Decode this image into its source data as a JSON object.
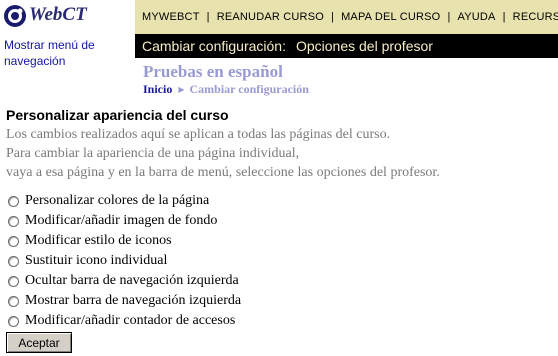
{
  "logo": {
    "text": "WebCT",
    "mark_icon": "webct-logo-icon"
  },
  "topnav": {
    "items": [
      "MYWEBCT",
      "REANUDAR CURSO",
      "MAPA DEL CURSO",
      "AYUDA",
      "RECURSOS"
    ],
    "separator": "|"
  },
  "sidebar": {
    "nav_link": "Mostrar menú de navegación"
  },
  "titlebar": {
    "label": "Cambiar configuración:",
    "value": "Opciones del profesor"
  },
  "course": {
    "title": "Pruebas en español"
  },
  "breadcrumb": {
    "home": "Inicio",
    "current": "Cambiar configuración"
  },
  "section": {
    "heading": "Personalizar apariencia del curso",
    "description": [
      "Los cambios realizados aquí se aplican a todas las páginas del curso.",
      "Para cambiar la apariencia de una página individual,",
      "vaya a esa página y en la barra de menú, seleccione las opciones del profesor."
    ]
  },
  "options": [
    "Personalizar colores de la página",
    "Modificar/añadir imagen de fondo",
    "Modificar estilo de iconos",
    "Sustituir icono individual",
    "Ocultar barra de navegación izquierda",
    "Mostrar barra de navegación izquierda",
    "Modificar/añadir contador de accesos"
  ],
  "accept_button": "Aceptar",
  "colors": {
    "topnav_bg": "#e8e2ae",
    "titlebar_bg": "#000000",
    "titlebar_text": "#f3eec3",
    "course_title": "#9a9ad2",
    "link": "#1515a6"
  }
}
